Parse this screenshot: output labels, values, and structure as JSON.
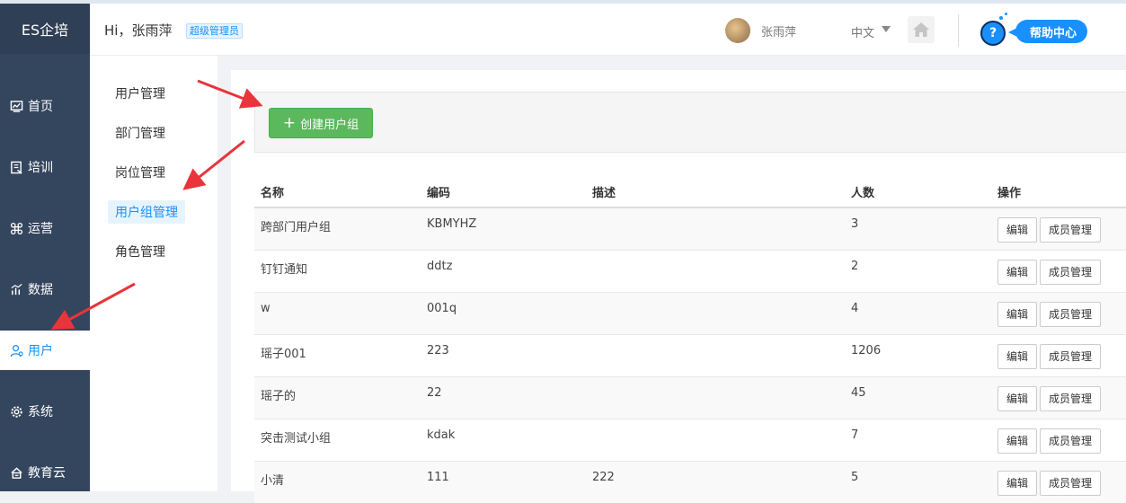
{
  "app": {
    "logo": "ES企培"
  },
  "nav": [
    {
      "label": "首页",
      "icon": "dashboard-icon"
    },
    {
      "label": "培训",
      "icon": "book-icon"
    },
    {
      "label": "运营",
      "icon": "command-icon"
    },
    {
      "label": "数据",
      "icon": "chart-icon"
    },
    {
      "label": "用户",
      "icon": "user-icon",
      "active": true
    },
    {
      "label": "系统",
      "icon": "gear-icon"
    },
    {
      "label": "教育云",
      "icon": "cloud-icon"
    }
  ],
  "header": {
    "greeting": "Hi，张雨萍",
    "role": "超级管理员",
    "username": "张雨萍",
    "language": "中文",
    "help": "帮助中心",
    "help_symbol": "?"
  },
  "submenu": [
    {
      "label": "用户管理"
    },
    {
      "label": "部门管理"
    },
    {
      "label": "岗位管理"
    },
    {
      "label": "用户组管理",
      "active": true
    },
    {
      "label": "角色管理"
    }
  ],
  "toolbar": {
    "create_label": "创建用户组",
    "create_symbol": "+"
  },
  "table": {
    "columns": [
      "名称",
      "编码",
      "描述",
      "人数",
      "操作"
    ],
    "rows": [
      {
        "name": "跨部门用户组",
        "code": "KBMYHZ",
        "desc": "",
        "count": "3"
      },
      {
        "name": "钉钉通知",
        "code": "ddtz",
        "desc": "",
        "count": "2"
      },
      {
        "name": "w",
        "code": "001q",
        "desc": "",
        "count": "4"
      },
      {
        "name": "瑶子001",
        "code": "223",
        "desc": "",
        "count": "1206"
      },
      {
        "name": "瑶子的",
        "code": "22",
        "desc": "",
        "count": "45"
      },
      {
        "name": "突击测试小组",
        "code": "kdak",
        "desc": "",
        "count": "7"
      },
      {
        "name": "小清",
        "code": "111",
        "desc": "222",
        "count": "5"
      }
    ],
    "edit_label": "编辑",
    "members_label": "成员管理"
  },
  "colors": {
    "sidebar": "#34455e",
    "accent": "#1890ff",
    "create": "#5cb85c",
    "arrow": "#e8343a"
  }
}
